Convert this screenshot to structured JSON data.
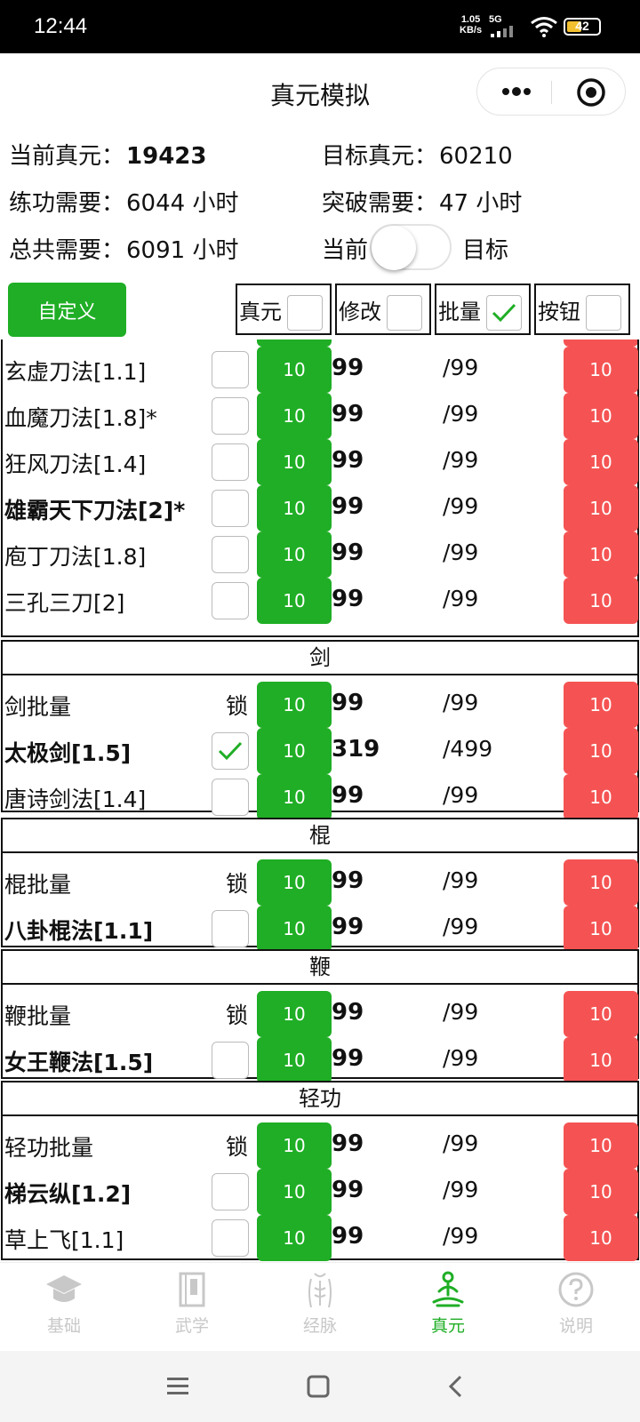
{
  "status": {
    "time": "12:44",
    "speed_top": "1.05",
    "speed_unit": "KB/s",
    "signal": "5G",
    "battery": "42"
  },
  "nav": {
    "title": "真元模拟"
  },
  "info": {
    "current_label": "当前真元：",
    "current_value": "19423",
    "target_label": "目标真元：",
    "target_value": "60210",
    "practice_label": "练功需要：",
    "practice_value": "6044 小时",
    "break_label": "突破需要：",
    "break_value": "47 小时",
    "total_label": "总共需要：",
    "total_value": "6091 小时",
    "toggle_left": "当前",
    "toggle_right": "目标"
  },
  "toolbar": {
    "custom_label": "自定义",
    "options": [
      {
        "label": "真元",
        "checked": false
      },
      {
        "label": "修改",
        "checked": false
      },
      {
        "label": "批量",
        "checked": true
      },
      {
        "label": "按钮",
        "checked": false
      }
    ]
  },
  "list": {
    "lock_label": "锁",
    "blade_rows": [
      {
        "name": "玄虚刀法[1.1]",
        "bold": false,
        "plus": "10",
        "value": "99",
        "max": "/99",
        "minus": "10"
      },
      {
        "name": "血魔刀法[1.8]*",
        "bold": false,
        "plus": "10",
        "value": "99",
        "max": "/99",
        "minus": "10"
      },
      {
        "name": "狂风刀法[1.4]",
        "bold": false,
        "plus": "10",
        "value": "99",
        "max": "/99",
        "minus": "10"
      },
      {
        "name": "雄霸天下刀法[2]*",
        "bold": true,
        "plus": "10",
        "value": "99",
        "max": "/99",
        "minus": "10"
      },
      {
        "name": "庖丁刀法[1.8]",
        "bold": false,
        "plus": "10",
        "value": "99",
        "max": "/99",
        "minus": "10"
      },
      {
        "name": "三孔三刀[2]",
        "bold": false,
        "plus": "10",
        "value": "99",
        "max": "/99",
        "minus": "10"
      }
    ],
    "sword": {
      "title": "剑",
      "batch_name": "剑批量",
      "batch": {
        "plus": "10",
        "value": "99",
        "max": "/99",
        "minus": "10"
      },
      "rows": [
        {
          "name": "太极剑[1.5]",
          "checked": true,
          "plus": "10",
          "value": "319",
          "max": "/499",
          "minus": "10"
        },
        {
          "name": "唐诗剑法[1.4]",
          "checked": false,
          "plus": "10",
          "value": "99",
          "max": "/99",
          "minus": "10"
        }
      ]
    },
    "staff": {
      "title": "棍",
      "batch_name": "棍批量",
      "batch": {
        "plus": "10",
        "value": "99",
        "max": "/99",
        "minus": "10"
      },
      "rows": [
        {
          "name": "八卦棍法[1.1]",
          "checked": false,
          "plus": "10",
          "value": "99",
          "max": "/99",
          "minus": "10"
        }
      ]
    },
    "whip": {
      "title": "鞭",
      "batch_name": "鞭批量",
      "batch": {
        "plus": "10",
        "value": "99",
        "max": "/99",
        "minus": "10"
      },
      "rows": [
        {
          "name": "女王鞭法[1.5]",
          "checked": false,
          "plus": "10",
          "value": "99",
          "max": "/99",
          "minus": "10"
        }
      ]
    },
    "qinggong": {
      "title": "轻功",
      "batch_name": "轻功批量",
      "batch": {
        "plus": "10",
        "value": "99",
        "max": "/99",
        "minus": "10"
      },
      "rows": [
        {
          "name": "梯云纵[1.2]",
          "checked": false,
          "plus": "10",
          "value": "99",
          "max": "/99",
          "minus": "10"
        },
        {
          "name": "草上飞[1.1]",
          "checked": false,
          "plus": "10",
          "value": "99",
          "max": "/99",
          "minus": "10"
        }
      ]
    }
  },
  "tabs": [
    {
      "label": "基础",
      "icon": "graduation-cap-icon",
      "active": false
    },
    {
      "label": "武学",
      "icon": "book-icon",
      "active": false
    },
    {
      "label": "经脉",
      "icon": "body-meridian-icon",
      "active": false
    },
    {
      "label": "真元",
      "icon": "meditation-icon",
      "active": true
    },
    {
      "label": "说明",
      "icon": "question-icon",
      "active": false
    }
  ],
  "colors": {
    "green": "#1fae25",
    "red": "#f55353",
    "active_tab": "#1fae25",
    "inactive_tab": "#c8c8c8"
  }
}
